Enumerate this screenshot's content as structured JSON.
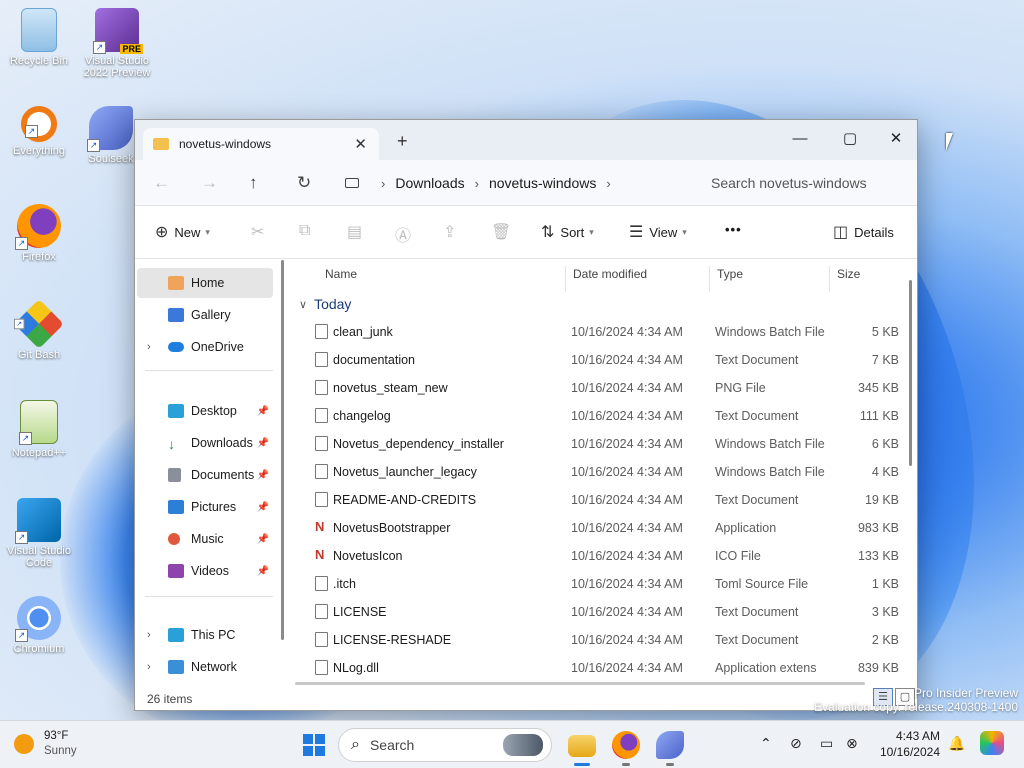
{
  "desktop": {
    "icons": [
      {
        "label": "Recycle Bin"
      },
      {
        "label": "Visual Studio 2022 Preview",
        "badge": "PRE"
      },
      {
        "label": "Everything"
      },
      {
        "label": "Soulseek"
      },
      {
        "label": "Firefox"
      },
      {
        "label": "Git Bash"
      },
      {
        "label": "Notepad++"
      },
      {
        "label": "Visual Studio Code"
      },
      {
        "label": "Chromium"
      }
    ],
    "watermark_line1": "Pro Insider Preview",
    "watermark_line2": "Evaluation copy. release.240308-1400"
  },
  "window": {
    "tab_title": "novetus-windows",
    "tab_close": "✕",
    "new_tab": "+",
    "minimize": "—",
    "maximize": "▢",
    "close": "✕",
    "breadcrumb": [
      "Downloads",
      "novetus-windows"
    ],
    "search_placeholder": "Search novetus-windows",
    "commands": {
      "new": "New",
      "sort": "Sort",
      "view": "View",
      "more": "•••",
      "details": "Details"
    },
    "nav": {
      "home": "Home",
      "gallery": "Gallery",
      "onedrive": "OneDrive",
      "desktop": "Desktop",
      "downloads": "Downloads",
      "documents": "Documents",
      "pictures": "Pictures",
      "music": "Music",
      "videos": "Videos",
      "thispc": "This PC",
      "network": "Network"
    },
    "columns": {
      "name": "Name",
      "date": "Date modified",
      "type": "Type",
      "size": "Size"
    },
    "group": "Today",
    "files": [
      {
        "name": "clean_junk",
        "date": "10/16/2024 4:34 AM",
        "type": "Windows Batch File",
        "size": "5 KB"
      },
      {
        "name": "documentation",
        "date": "10/16/2024 4:34 AM",
        "type": "Text Document",
        "size": "7 KB"
      },
      {
        "name": "novetus_steam_new",
        "date": "10/16/2024 4:34 AM",
        "type": "PNG File",
        "size": "345 KB"
      },
      {
        "name": "changelog",
        "date": "10/16/2024 4:34 AM",
        "type": "Text Document",
        "size": "111 KB"
      },
      {
        "name": "Novetus_dependency_installer",
        "date": "10/16/2024 4:34 AM",
        "type": "Windows Batch File",
        "size": "6 KB"
      },
      {
        "name": "Novetus_launcher_legacy",
        "date": "10/16/2024 4:34 AM",
        "type": "Windows Batch File",
        "size": "4 KB"
      },
      {
        "name": "README-AND-CREDITS",
        "date": "10/16/2024 4:34 AM",
        "type": "Text Document",
        "size": "19 KB"
      },
      {
        "name": "NovetusBootstrapper",
        "date": "10/16/2024 4:34 AM",
        "type": "Application",
        "size": "983 KB"
      },
      {
        "name": "NovetusIcon",
        "date": "10/16/2024 4:34 AM",
        "type": "ICO File",
        "size": "133 KB"
      },
      {
        "name": ".itch",
        "date": "10/16/2024 4:34 AM",
        "type": "Toml Source File",
        "size": "1 KB"
      },
      {
        "name": "LICENSE",
        "date": "10/16/2024 4:34 AM",
        "type": "Text Document",
        "size": "3 KB"
      },
      {
        "name": "LICENSE-RESHADE",
        "date": "10/16/2024 4:34 AM",
        "type": "Text Document",
        "size": "2 KB"
      },
      {
        "name": "NLog.dll",
        "date": "10/16/2024 4:34 AM",
        "type": "Application extens",
        "size": "839 KB"
      }
    ],
    "status_count": "26 items"
  },
  "taskbar": {
    "temperature": "93°F",
    "condition": "Sunny",
    "search_label": "Search",
    "time": "4:43 AM",
    "date": "10/16/2024"
  },
  "colors": {
    "accent": "#0067c0",
    "folder": "#f2c14e",
    "selection": "#e5e5e5"
  }
}
